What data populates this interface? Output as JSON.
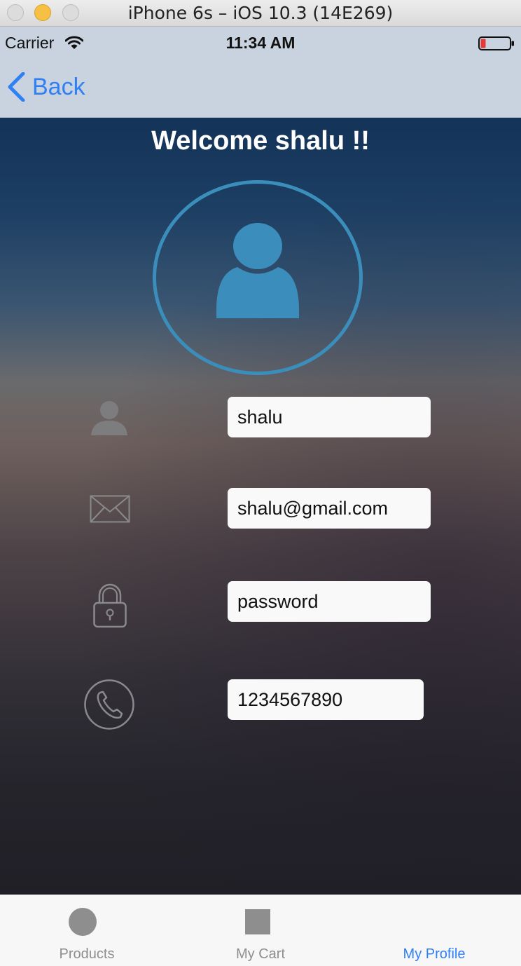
{
  "window": {
    "title": "iPhone 6s – iOS 10.3 (14E269)"
  },
  "status_bar": {
    "carrier": "Carrier",
    "time": "11:34 AM"
  },
  "nav": {
    "back_label": "Back"
  },
  "header": {
    "welcome": "Welcome  shalu  !!"
  },
  "form": {
    "name": "shalu",
    "email": "shalu@gmail.com",
    "password": "password",
    "phone": "1234567890"
  },
  "tabs": [
    {
      "label": "Products",
      "icon": "circle-icon"
    },
    {
      "label": "My Cart",
      "icon": "square-icon"
    },
    {
      "label": "My Profile",
      "icon": "none",
      "active": true
    }
  ],
  "colors": {
    "accent": "#2f7ff5",
    "avatar": "#3b8ebb",
    "inactive": "#8e8e8e"
  }
}
